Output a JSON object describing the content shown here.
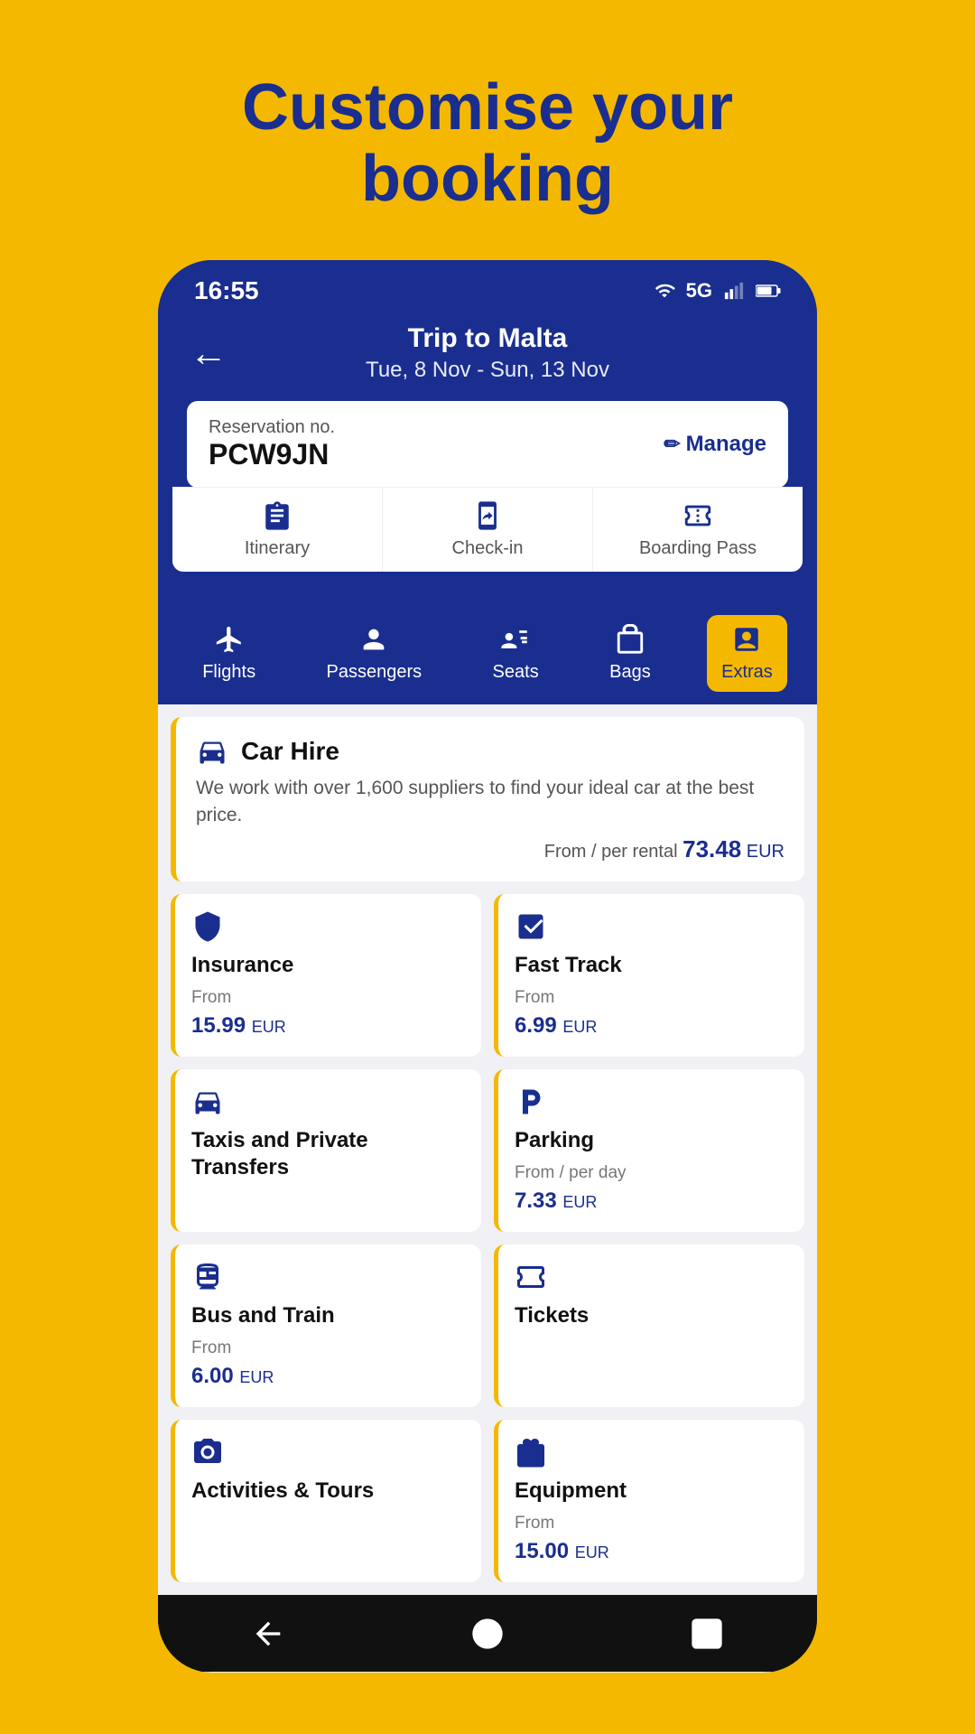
{
  "page": {
    "title_line1": "Customise your",
    "title_line2": "booking"
  },
  "status_bar": {
    "time": "16:55",
    "signal_5g": "5G"
  },
  "header": {
    "trip_name": "Trip to Malta",
    "trip_dates": "Tue, 8 Nov - Sun, 13 Nov",
    "back_label": "←"
  },
  "reservation": {
    "label": "Reservation no.",
    "code": "PCW9JN",
    "manage_label": "Manage"
  },
  "card_tabs": [
    {
      "id": "itinerary",
      "label": "Itinerary"
    },
    {
      "id": "check-in",
      "label": "Check-in"
    },
    {
      "id": "boarding-pass",
      "label": "Boarding Pass"
    }
  ],
  "nav_tabs": [
    {
      "id": "flights",
      "label": "Flights",
      "active": false
    },
    {
      "id": "passengers",
      "label": "Passengers",
      "active": false
    },
    {
      "id": "seats",
      "label": "Seats",
      "active": false
    },
    {
      "id": "bags",
      "label": "Bags",
      "active": false
    },
    {
      "id": "extras",
      "label": "Extras",
      "active": true
    }
  ],
  "car_hire": {
    "title": "Car Hire",
    "description": "We work with over 1,600 suppliers to find your ideal car at the best price.",
    "price_label": "From / per rental",
    "price": "73.48",
    "currency": "EUR"
  },
  "services": [
    {
      "id": "insurance",
      "title": "Insurance",
      "from_label": "From",
      "price": "15.99",
      "currency": "EUR",
      "per": ""
    },
    {
      "id": "fast-track",
      "title": "Fast Track",
      "from_label": "From",
      "price": "6.99",
      "currency": "EUR",
      "per": ""
    },
    {
      "id": "taxis",
      "title": "Taxis and Private Transfers",
      "from_label": "",
      "price": "",
      "currency": "",
      "per": ""
    },
    {
      "id": "parking",
      "title": "Parking",
      "from_label": "From / per day",
      "price": "7.33",
      "currency": "EUR",
      "per": ""
    },
    {
      "id": "bus-train",
      "title": "Bus and Train",
      "from_label": "From",
      "price": "6.00",
      "currency": "EUR",
      "per": ""
    },
    {
      "id": "tickets",
      "title": "Tickets",
      "from_label": "",
      "price": "",
      "currency": "",
      "per": ""
    },
    {
      "id": "activities",
      "title": "Activities & Tours",
      "from_label": "",
      "price": "",
      "currency": "",
      "per": ""
    },
    {
      "id": "equipment",
      "title": "Equipment",
      "from_label": "From",
      "price": "15.00",
      "currency": "EUR",
      "per": ""
    }
  ],
  "bottom_nav": {
    "back_label": "◀",
    "home_label": "●",
    "square_label": "■"
  }
}
